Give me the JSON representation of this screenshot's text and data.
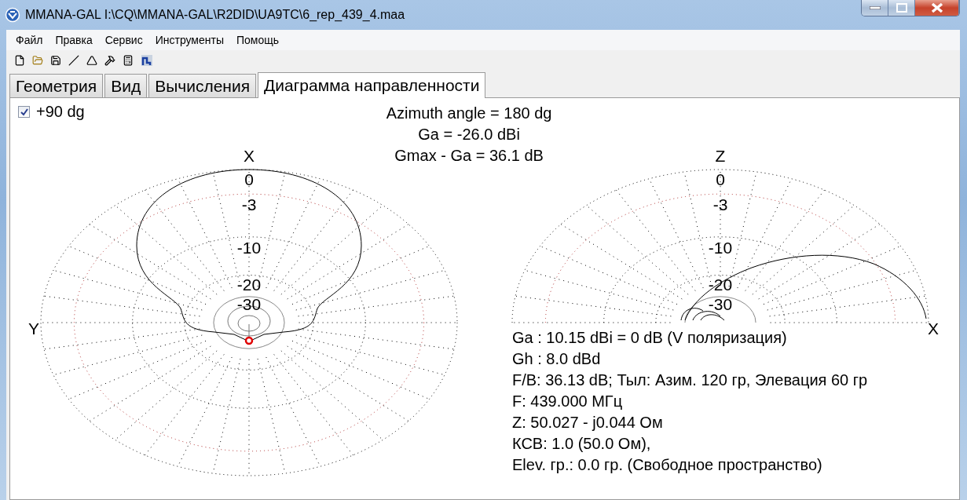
{
  "window": {
    "title": "MMANA-GAL I:\\CQ\\MMANA-GAL\\R2DID\\UA9TC\\6_rep_439_4.maa"
  },
  "menu": [
    "Файл",
    "Правка",
    "Сервис",
    "Инструменты",
    "Помощь"
  ],
  "tabs": [
    {
      "label": "Геометрия",
      "selected": false
    },
    {
      "label": "Вид",
      "selected": false
    },
    {
      "label": "Вычисления",
      "selected": false
    },
    {
      "label": "Диаграмма направленности",
      "selected": true
    }
  ],
  "option": {
    "label": "+90 dg",
    "checked": true
  },
  "header": [
    "Azimuth angle = 180 dg",
    "Ga = -26.0 dBi",
    "Gmax - Ga = 36.1 dB"
  ],
  "plots": [
    {
      "kind": "horizontal",
      "axis_top": "X",
      "axis_side": "Y",
      "ring_labels": [
        "0",
        "-3",
        "-10",
        "-20",
        "-30"
      ]
    },
    {
      "kind": "vertical",
      "axis_top": "Z",
      "axis_side": "X",
      "ring_labels": [
        "0",
        "-3",
        "-10",
        "-20",
        "-30"
      ]
    }
  ],
  "results": [
    "Ga : 10.15 dBi = 0 dB  (V поляризация)",
    "Gh : 8.0 dBd",
    "F/B: 36.13 dB; Тыл: Азим. 120 гр, Элевация 60 гр",
    "F: 439.000 МГц",
    "Z: 50.027 - j0.044 Ом",
    "КСВ: 1.0 (50.0 Ом),",
    "Elev. гр.: 0.0 гр. (Свободное пространство)"
  ]
}
